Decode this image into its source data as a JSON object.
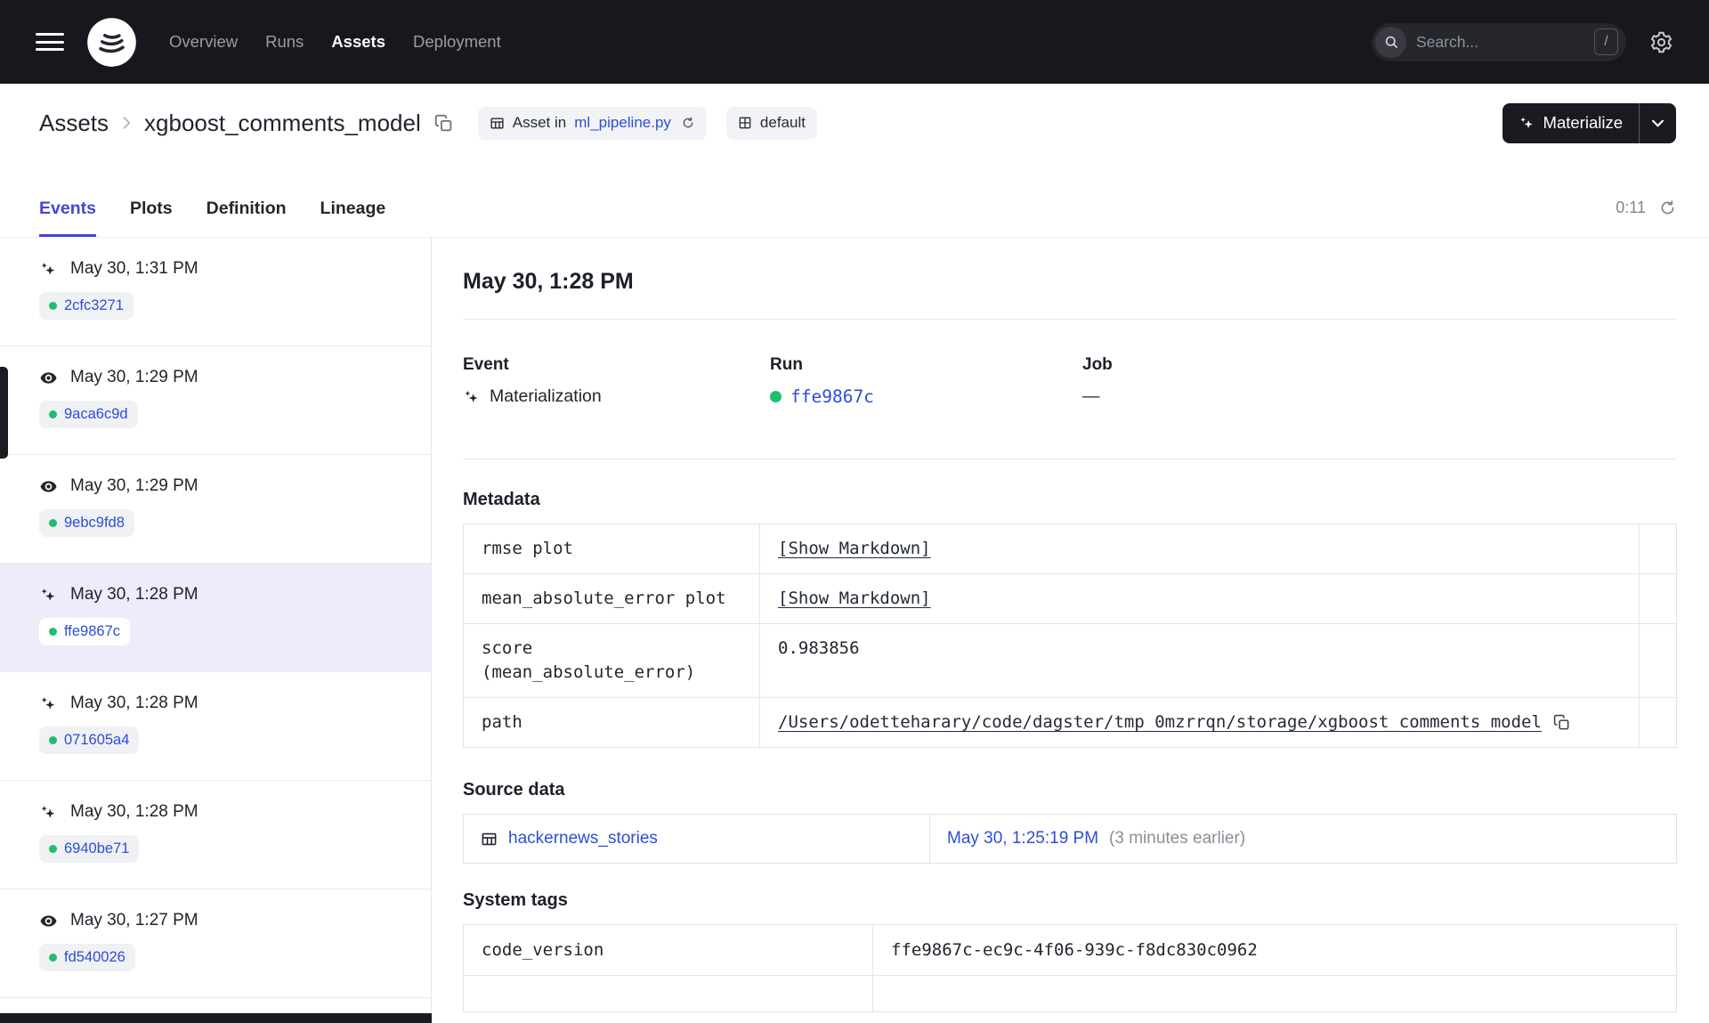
{
  "colors": {
    "accent": "#4644D4",
    "link": "#2D4ED6",
    "success": "#1FBE6E",
    "nav_bg": "#17171D"
  },
  "nav": {
    "items": [
      "Overview",
      "Runs",
      "Assets",
      "Deployment"
    ],
    "active_item": "Assets",
    "search": {
      "placeholder": "Search...",
      "shortcut": "/"
    }
  },
  "header": {
    "breadcrumb_root": "Assets",
    "title": "xgboost_comments_model",
    "asset_location_prefix": "Asset in",
    "asset_location_file": "ml_pipeline.py",
    "group_tag": "default",
    "materialize_button": "Materialize"
  },
  "tabs": {
    "items": [
      "Events",
      "Plots",
      "Definition",
      "Lineage"
    ],
    "active": "Events",
    "timer": "0:11"
  },
  "sidebar": {
    "items": [
      {
        "type": "materialization",
        "date": "May 30, 1:31 PM",
        "run_id": "2cfc3271",
        "selected": false
      },
      {
        "type": "observation",
        "date": "May 30, 1:29 PM",
        "run_id": "9aca6c9d",
        "selected": false
      },
      {
        "type": "observation",
        "date": "May 30, 1:29 PM",
        "run_id": "9ebc9fd8",
        "selected": false
      },
      {
        "type": "materialization",
        "date": "May 30, 1:28 PM",
        "run_id": "ffe9867c",
        "selected": true
      },
      {
        "type": "materialization",
        "date": "May 30, 1:28 PM",
        "run_id": "071605a4",
        "selected": false
      },
      {
        "type": "materialization",
        "date": "May 30, 1:28 PM",
        "run_id": "6940be71",
        "selected": false
      },
      {
        "type": "observation",
        "date": "May 30, 1:27 PM",
        "run_id": "fd540026",
        "selected": false
      }
    ]
  },
  "detail": {
    "title": "May 30, 1:28 PM",
    "event": {
      "label": "Event",
      "value": "Materialization"
    },
    "run": {
      "label": "Run",
      "value": "ffe9867c"
    },
    "job": {
      "label": "Job",
      "value": "—"
    },
    "metadata": {
      "heading": "Metadata",
      "rows": [
        {
          "key": "rmse plot",
          "value": "[Show Markdown]"
        },
        {
          "key": "mean_absolute_error plot",
          "value": "[Show Markdown]"
        },
        {
          "key": "score\n(mean_absolute_error)",
          "value": "0.983856"
        },
        {
          "key": "path",
          "value": "/Users/odetteharary/code/dagster/tmp_0mzrrqn/storage/xgboost_comments_model"
        }
      ]
    },
    "source_data": {
      "heading": "Source data",
      "asset": "hackernews_stories",
      "timestamp": "May 30, 1:25:19 PM",
      "note": "(3 minutes earlier)"
    },
    "system_tags": {
      "heading": "System tags",
      "rows": [
        {
          "key": "code_version",
          "value": "ffe9867c-ec9c-4f06-939c-f8dc830c0962"
        }
      ]
    }
  }
}
